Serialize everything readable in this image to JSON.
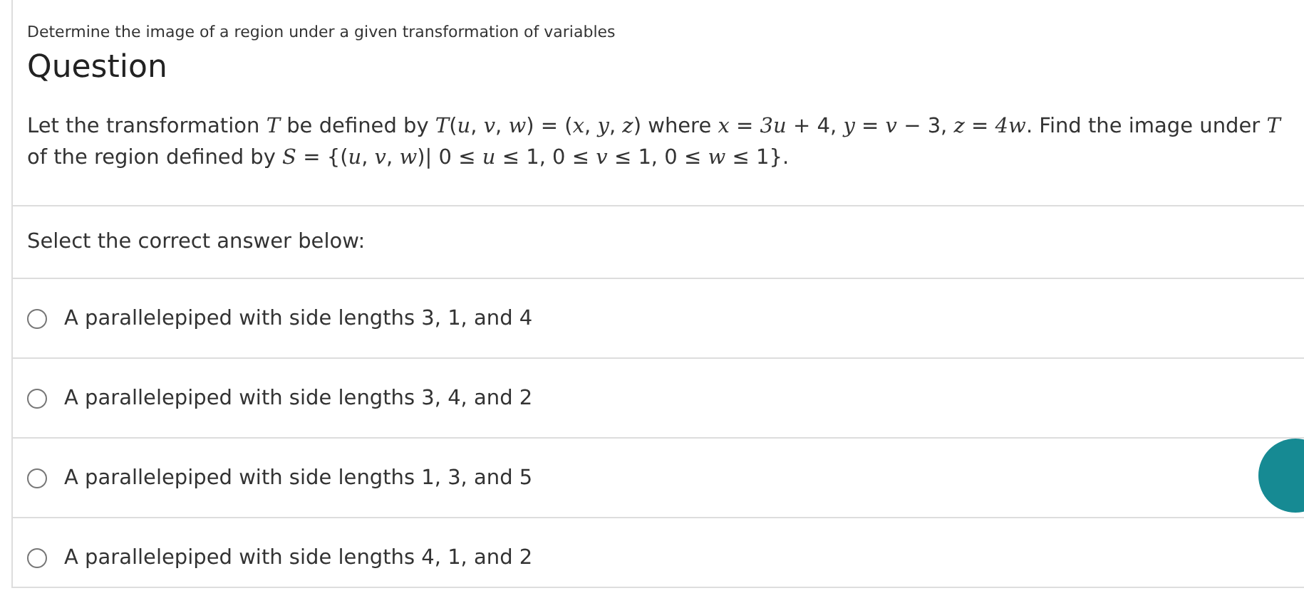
{
  "breadcrumb": "Determine the image of a region under a given transformation of variables",
  "heading": "Question",
  "question": "Let the transformation *T* be defined by *T*(*u*, *v*, *w*) = (*x*, *y*, *z*) where *x* = *3u* + 4, *y* = *v* − 3, *z* = *4w*. Find the image under *T* of the region defined by *S* = {(*u*, *v*, *w*)| 0 ≤ *u* ≤ 1, 0 ≤ *v* ≤ 1, 0 ≤ *w* ≤ 1}.",
  "prompt": "Select the correct answer below:",
  "options": [
    {
      "label": "A parallelepiped with side lengths 3, 1, and 4",
      "selected": false
    },
    {
      "label": "A parallelepiped with side lengths 3, 4, and 2",
      "selected": false
    },
    {
      "label": "A parallelepiped with side lengths 1, 3, and 5",
      "selected": false
    },
    {
      "label": "A parallelepiped with side lengths 4, 1, and 2",
      "selected": false
    }
  ]
}
